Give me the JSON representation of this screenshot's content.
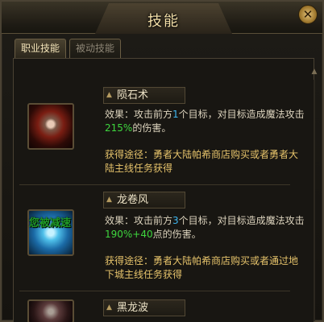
{
  "window": {
    "title": "技能"
  },
  "tabs": [
    {
      "label": "职业技能",
      "active": true
    },
    {
      "label": "被动技能",
      "active": false
    }
  ],
  "skills": [
    {
      "name": "陨石术",
      "effect_prefix": "效果：攻击前方",
      "targets": "1",
      "effect_mid": "个目标，对目标造成魔法攻击",
      "percent": "215%",
      "effect_suffix": "的伤害。",
      "source": "获得途径：勇者大陆帕希商店购买或者勇者大陆主线任务获得",
      "icon": "meteor-icon"
    },
    {
      "name": "龙卷风",
      "effect_prefix": "效果：攻击前方",
      "targets": "3",
      "effect_mid": "个目标，对目标造成魔法攻击",
      "percent": "190%+40",
      "effect_suffix": "点的伤害。",
      "source": "获得途径：勇者大陆帕希商店购买或者通过地下城主线任务获得",
      "icon": "tornado-icon",
      "overlay": "您被减速"
    },
    {
      "name": "黑龙波",
      "icon": "black-dragon-wave-icon"
    }
  ],
  "colors": {
    "highlight_blue": "#3fb7f0",
    "highlight_green": "#3ed63e",
    "source_gold": "#e6c36b"
  }
}
